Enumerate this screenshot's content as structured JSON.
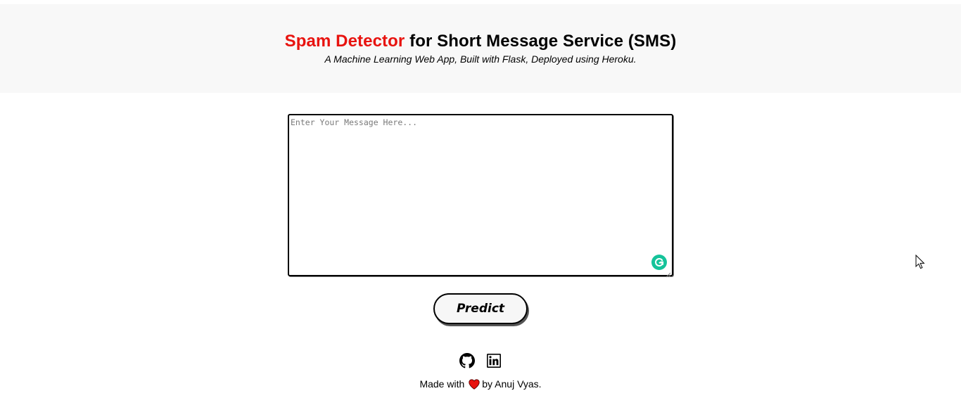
{
  "header": {
    "title_accent": "Spam Detector",
    "title_rest": " for Short Message Service (SMS)",
    "subtitle": "A Machine Learning Web App, Built with Flask, Deployed using Heroku."
  },
  "form": {
    "message_value": "",
    "message_placeholder": "Enter Your Message Here...",
    "predict_label": "Predict"
  },
  "links": {
    "github_icon": "github-icon",
    "linkedin_icon": "linkedin-icon"
  },
  "footer": {
    "made_with": "Made with",
    "heart_icon": "heart-icon",
    "by_author": "by Anuj Vyas."
  },
  "colors": {
    "accent": "#e8130f",
    "header_bg": "#f8f8f8",
    "grammarly": "#15c39a",
    "heart": "#e8130f"
  }
}
